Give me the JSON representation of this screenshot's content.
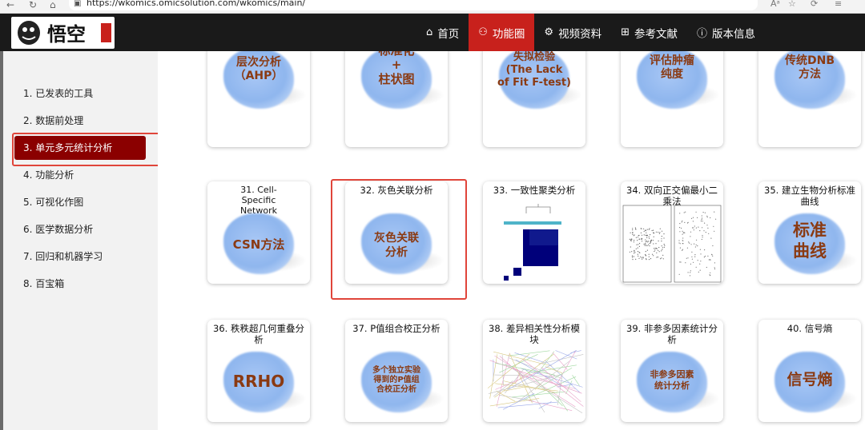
{
  "browser": {
    "url": "https://wkomics.omicsolution.com/wkomics/main/",
    "right_glyphs": [
      "Aᵃ",
      "☆",
      "⟳",
      "≡"
    ]
  },
  "logo": {
    "text": "悟空"
  },
  "nav": [
    {
      "icon": "home-icon",
      "glyph": "⌂",
      "label": "首页",
      "active": false
    },
    {
      "icon": "binoculars-icon",
      "glyph": "⚇",
      "label": "功能圈",
      "active": true
    },
    {
      "icon": "gears-icon",
      "glyph": "⚙",
      "label": "视频资料",
      "active": false
    },
    {
      "icon": "table-icon",
      "glyph": "⊞",
      "label": "参考文献",
      "active": false
    },
    {
      "icon": "info-icon",
      "glyph": "ⓘ",
      "label": "版本信息",
      "active": false
    }
  ],
  "sidebar": {
    "items": [
      {
        "label": "1. 已发表的工具"
      },
      {
        "label": "2. 数据前处理"
      },
      {
        "label": "3. 单元多元统计分析",
        "active": true
      },
      {
        "label": "4. 功能分析"
      },
      {
        "label": "5. 可视化作图"
      },
      {
        "label": "6. 医学数据分析"
      },
      {
        "label": "7. 回归和机器学习"
      },
      {
        "label": "8. 百宝箱"
      }
    ]
  },
  "cards": {
    "row1": [
      {
        "caption": "",
        "image_text": "层次分析\n（AHP）"
      },
      {
        "caption": "",
        "image_text": "标准化\n+\n柱状图"
      },
      {
        "caption": "",
        "image_text": "失拟检验\n(The Lack\nof Fit F-test)"
      },
      {
        "caption": "",
        "image_text": "评估肿瘤\n纯度"
      },
      {
        "caption": "",
        "image_text": "传统DNB\n方法"
      }
    ],
    "row2": [
      {
        "caption": "31. Cell-Specific Network",
        "image_text": "CSN方法"
      },
      {
        "caption": "32. 灰色关联分析",
        "image_text": "灰色关联\n分析"
      },
      {
        "caption": "33. 一致性聚类分析",
        "image_text": ""
      },
      {
        "caption": "34. 双向正交偏最小二乘法",
        "image_text": ""
      },
      {
        "caption": "35. 建立生物分析标准曲线",
        "image_text": "标准\n曲线"
      }
    ],
    "row3": [
      {
        "caption": "36. 秩秩超几何重叠分析",
        "image_text": "RRHO"
      },
      {
        "caption": "37. P值组合校正分析",
        "image_text": "多个独立实验\n得到的P值组\n合校正分析"
      },
      {
        "caption": "38. 差异相关性分析模块",
        "image_text": ""
      },
      {
        "caption": "39. 非参多因素统计分析",
        "image_text": "非参多因素\n统计分析"
      },
      {
        "caption": "40. 信号熵",
        "image_text": "信号熵"
      }
    ]
  }
}
